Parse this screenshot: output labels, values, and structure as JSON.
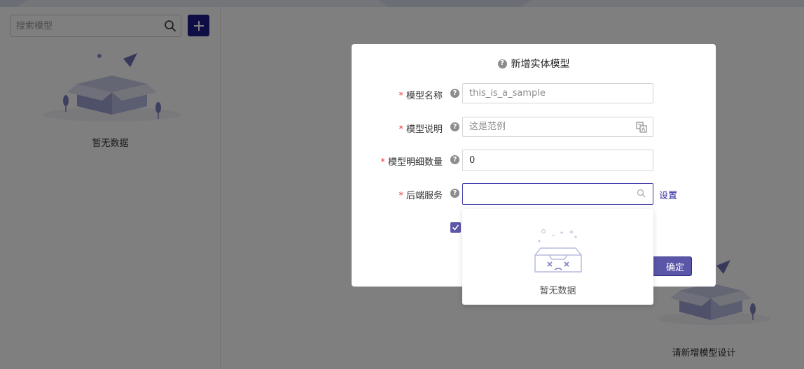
{
  "sidebar": {
    "search_placeholder": "搜索模型",
    "empty_text": "暂无数据"
  },
  "main": {
    "empty_text": "请新增模型设计"
  },
  "modal": {
    "title": "新增实体模型",
    "fields": {
      "name": {
        "label": "模型名称",
        "placeholder": "this_is_a_sample"
      },
      "description": {
        "label": "模型说明",
        "placeholder": "这是范例"
      },
      "detail_count": {
        "label": "模型明细数量",
        "value": "0"
      },
      "backend": {
        "label": "后端服务",
        "value": ""
      }
    },
    "required_mark": "*",
    "help_glyph": "?",
    "settings_link": "设置",
    "confirm_label": "确定"
  },
  "dropdown": {
    "empty_text": "暂无数据"
  },
  "colors": {
    "primary": "#1f1a8a",
    "confirm": "#5a56a8",
    "link": "#2b25a0",
    "required": "#e43c3c"
  }
}
